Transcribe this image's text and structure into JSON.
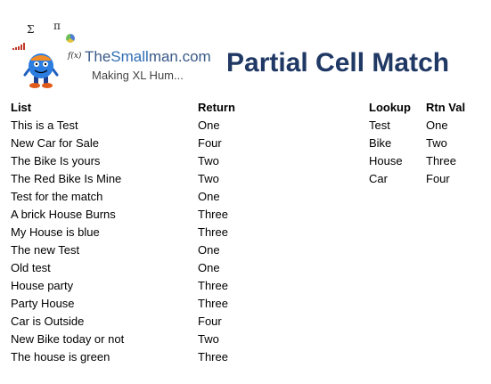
{
  "logo": {
    "sigma": "Σ",
    "pi": "π",
    "fx": "f(x)",
    "brand_part1": "The",
    "brand_part2": "Small",
    "brand_part3": "man.com",
    "tagline": "Making XL Hum..."
  },
  "title": "Partial Cell Match",
  "main_table": {
    "headers": [
      "List",
      "Return"
    ],
    "rows": [
      [
        "This is a Test",
        "One"
      ],
      [
        "New Car for Sale",
        "Four"
      ],
      [
        "The Bike Is yours",
        "Two"
      ],
      [
        "The Red Bike Is Mine",
        "Two"
      ],
      [
        "Test for the match",
        "One"
      ],
      [
        "A brick House Burns",
        "Three"
      ],
      [
        "My House is blue",
        "Three"
      ],
      [
        "The new Test",
        "One"
      ],
      [
        "Old test",
        "One"
      ],
      [
        "House party",
        "Three"
      ],
      [
        "Party House",
        "Three"
      ],
      [
        "Car is Outside",
        "Four"
      ],
      [
        "New Bike today or not",
        "Two"
      ],
      [
        "The house is green",
        "Three"
      ]
    ]
  },
  "lookup_table": {
    "headers": [
      "Lookup",
      "Rtn Val"
    ],
    "rows": [
      [
        "Test",
        "One"
      ],
      [
        "Bike",
        "Two"
      ],
      [
        "House",
        "Three"
      ],
      [
        "Car",
        "Four"
      ]
    ]
  }
}
